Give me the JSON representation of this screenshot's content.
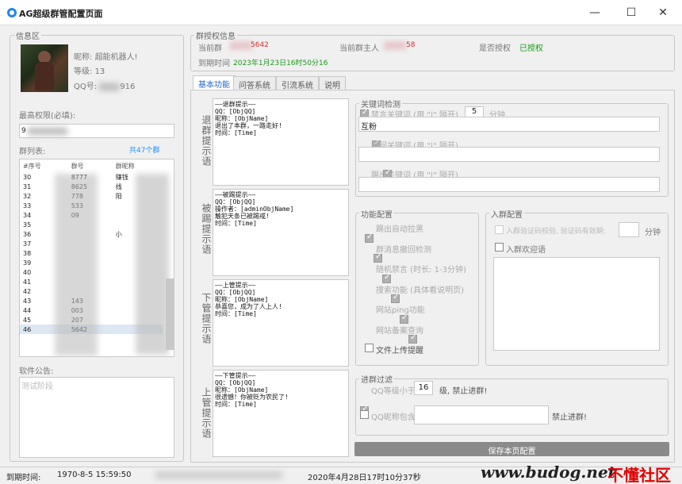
{
  "window": {
    "title": "AG超级群管配置页面",
    "minimize": "—",
    "maximize": "☐",
    "close": "✕"
  },
  "info": {
    "group_label": "信息区",
    "nickname_label": "昵称:",
    "nickname": "超能机器人!",
    "level_label": "等级:",
    "level": "13",
    "qq_label": "QQ号:",
    "qq_suffix": "916",
    "admin_label": "最高权限(必填):",
    "admin_value": "9",
    "group_list_label": "群列表:",
    "group_count": "共47个群",
    "list_headers": [
      "#序号",
      "群号",
      "群昵称"
    ],
    "list_rows": [
      {
        "no": "30",
        "num": "8777",
        "name": "赚钱"
      },
      {
        "no": "31",
        "num": "8625",
        "name": "线"
      },
      {
        "no": "32",
        "num": "778",
        "name": "阳"
      },
      {
        "no": "33",
        "num": "533",
        "name": ""
      },
      {
        "no": "34",
        "num": "09",
        "name": ""
      },
      {
        "no": "35",
        "num": "",
        "name": ""
      },
      {
        "no": "36",
        "num": "",
        "name": "小"
      },
      {
        "no": "37",
        "num": "",
        "name": ""
      },
      {
        "no": "38",
        "num": "",
        "name": ""
      },
      {
        "no": "39",
        "num": "",
        "name": ""
      },
      {
        "no": "40",
        "num": "",
        "name": ""
      },
      {
        "no": "41",
        "num": "",
        "name": ""
      },
      {
        "no": "42",
        "num": "",
        "name": ""
      },
      {
        "no": "43",
        "num": "143",
        "name": ""
      },
      {
        "no": "44",
        "num": "003",
        "name": ""
      },
      {
        "no": "45",
        "num": "207",
        "name": ""
      },
      {
        "no": "46",
        "num": "5642",
        "name": ""
      }
    ],
    "notice_label": "软件公告:",
    "notice_text": "测试阶段"
  },
  "auth": {
    "group_label": "群授权信息",
    "current_group_label": "当前群",
    "current_group_suffix": "5642",
    "owner_label": "当前群主人",
    "owner_suffix": "58",
    "authorized_label": "是否授权",
    "authorized_value": "已授权",
    "expire_label": "到期时间",
    "expire_value": "2023年1月23日16时50分16"
  },
  "tabs": [
    "基本功能",
    "问答系统",
    "引流系统",
    "说明"
  ],
  "prompts": [
    {
      "label": "退群提示语",
      "text": "——退群提示——\nQQ：[ObjQQ]\n昵称：[ObjName]\n退出了本群，一路走好!\n时间：[Time]"
    },
    {
      "label": "被踢提示语",
      "text": "——被踢提示——\nQQ：[ObjQQ]\n操作者：[adminObjName]\n触犯天条已被踢戒!\n时间：[Time]"
    },
    {
      "label": "下管提示语",
      "text": "——上管提示——\nQQ：[ObjQQ]\n昵称：[ObjName]\n恭喜您，成为了人上人!\n时间：[Time]"
    },
    {
      "label": "上管提示语",
      "text": "——下管提示——\nQQ：[ObjQQ]\n昵称：[ObjName]\n很遗憾！你被贬为农民了!\n时间：[Time]"
    }
  ],
  "keywords": {
    "group_label": "关键词检测",
    "ban_label": "禁言关键词 (用 \"|\" 隔开)",
    "ban_minutes": "5",
    "minute_unit": "分钟",
    "ban_value": "互粉",
    "recall_label": "撤回关键词 (用 \"|\" 隔开)",
    "recall_value": "",
    "kick_label": "踢出关键词 (用 \"|\" 隔开)",
    "kick_value": ""
  },
  "functions": {
    "group_label": "功能配置",
    "items": [
      {
        "label": "踢出自动拉黑",
        "checked": true
      },
      {
        "label": "群消息撤回检测",
        "checked": true
      },
      {
        "label": "随机禁言 (时长: 1-3分钟)",
        "checked": true
      },
      {
        "label": "搜索功能 (具体看说明页)",
        "checked": true
      },
      {
        "label": "网站ping功能",
        "checked": true
      },
      {
        "label": "网站备案查询",
        "checked": true
      },
      {
        "label": "文件上传提醒",
        "checked": false
      }
    ]
  },
  "join": {
    "group_label": "入群配置",
    "verify_label": "入群验证码校验, 验证码有效期:",
    "verify_unit": "分钟",
    "welcome_label": "入群欢迎语"
  },
  "filter": {
    "group_label": "进群过滤",
    "level_label": "QQ等级小于",
    "level_value": "16",
    "level_suffix": "级, 禁止进群!",
    "nick_label": "QQ昵称包含",
    "nick_suffix": "禁止进群!"
  },
  "save_button": "保存本页配置",
  "status": {
    "time_label": "到期时间:",
    "time_value": "1970-8-5 15:59:50",
    "now_value": "2020年4月28日17时10分37秒",
    "watermark": "www.budog.net",
    "watermark_brand": "不懂社区"
  }
}
